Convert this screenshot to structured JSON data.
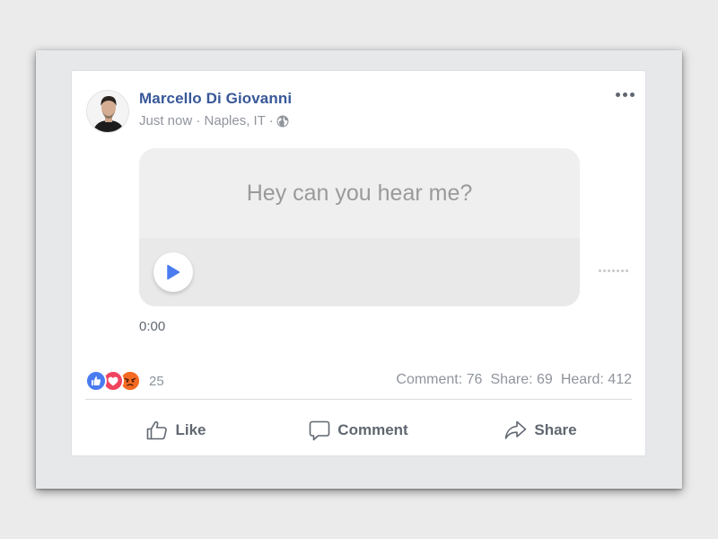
{
  "post": {
    "author": "Marcello Di Giovanni",
    "meta": "Just now · Naples, IT ·",
    "privacy_icon": "globe-icon",
    "more_icon": "more-horizontal-icon"
  },
  "voice_message": {
    "transcript": "Hey can you hear me?",
    "play_icon": "play-icon",
    "elapsed_time": "0:00"
  },
  "reactions": {
    "icons": [
      "like-reaction-icon",
      "love-reaction-icon",
      "angry-reaction-icon"
    ],
    "count": "25"
  },
  "stats": {
    "comments": "Comment: 76",
    "shares": "Share: 69",
    "heard": "Heard: 412"
  },
  "actions": {
    "like": "Like",
    "comment": "Comment",
    "share": "Share"
  },
  "colors": {
    "author_link": "#385898",
    "accent_blue": "#4a7cf0",
    "love_red": "#f0445e",
    "angry_orange": "#f56a23"
  }
}
